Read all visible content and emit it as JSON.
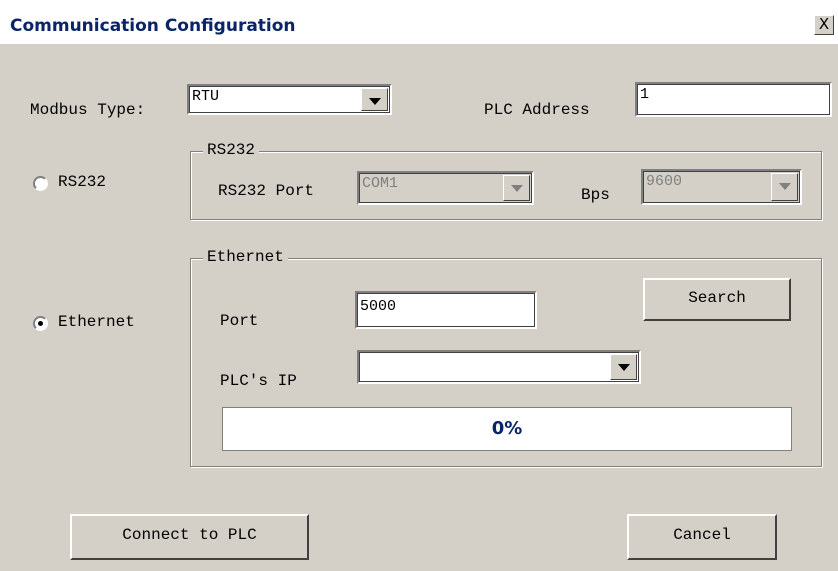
{
  "window": {
    "title": "Communication Configuration",
    "close_label": "X"
  },
  "modbus": {
    "label": "Modbus Type:",
    "value": "RTU"
  },
  "plc_address": {
    "label": "PLC Address",
    "value": "1"
  },
  "rs232": {
    "radio_label": "RS232",
    "selected": false,
    "group_title": "RS232",
    "port_label": "RS232 Port",
    "port_value": "COM1",
    "bps_label": "Bps",
    "bps_value": "9600"
  },
  "ethernet": {
    "radio_label": "Ethernet",
    "selected": true,
    "group_title": "Ethernet",
    "port_label": "Port",
    "port_value": "5000",
    "search_label": "Search",
    "ip_label": "PLC's IP",
    "ip_value": "",
    "progress_text": "0%",
    "progress_fraction": 0
  },
  "buttons": {
    "connect_label": "Connect to PLC",
    "cancel_label": "Cancel"
  },
  "colors": {
    "title_text": "#0a246a",
    "face": "#d4d0c8",
    "progress_text": "#0a246a"
  }
}
